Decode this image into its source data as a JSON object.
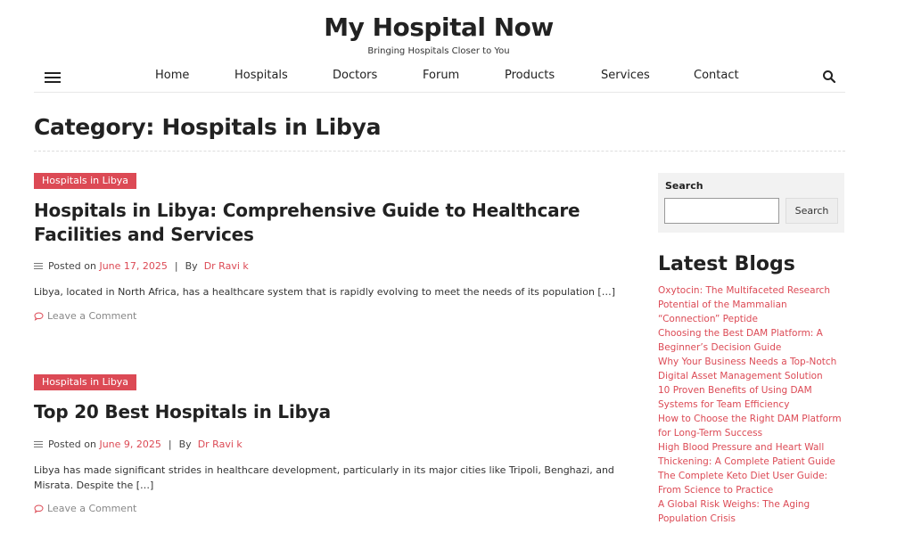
{
  "site": {
    "title": "My Hospital Now",
    "tagline": "Bringing Hospitals Closer to You"
  },
  "nav": {
    "menu_icon": "hamburger-icon",
    "items": [
      "Home",
      "Hospitals",
      "Doctors",
      "Forum",
      "Products",
      "Services",
      "Contact"
    ],
    "search_icon": "search-icon"
  },
  "page": {
    "title": "Category: Hospitals in Libya"
  },
  "posts": [
    {
      "category": "Hospitals in Libya",
      "title": "Hospitals in Libya: Comprehensive Guide to Healthcare Facilities and Services",
      "posted_on": "Posted on",
      "date": "June 17, 2025",
      "by": "By",
      "author": "Dr Ravi k",
      "excerpt": "Libya, located in North Africa, has a healthcare system that is rapidly evolving to meet the needs of its population […]",
      "comment": "Leave a Comment"
    },
    {
      "category": "Hospitals in Libya",
      "title": "Top 20 Best Hospitals in Libya",
      "posted_on": "Posted on",
      "date": "June 9, 2025",
      "by": "By",
      "author": "Dr Ravi k",
      "excerpt": "Libya has made significant strides in healthcare development, particularly in its major cities like Tripoli, Benghazi, and Misrata. Despite the […]",
      "comment": "Leave a Comment"
    }
  ],
  "sidebar": {
    "search": {
      "label": "Search",
      "input_value": "",
      "button": "Search"
    },
    "latest_title": "Latest Blogs",
    "latest_items": [
      "Oxytocin: The Multifaceted Research Potential of the Mammalian “Connection” Peptide",
      "Choosing the Best DAM Platform: A Beginner’s Decision Guide",
      "Why Your Business Needs a Top-Notch Digital Asset Management Solution",
      "10 Proven Benefits of Using DAM Systems for Team Efficiency",
      "How to Choose the Right DAM Platform for Long-Term Success",
      "High Blood Pressure and Heart Wall Thickening: A Complete Patient Guide",
      "The Complete Keto Diet User Guide: From Science to Practice",
      "A Global Risk Weighs: The Aging Population Crisis"
    ]
  },
  "colors": {
    "accent": "#dc4a55",
    "text": "#222222",
    "sidebar_bg": "#f2f2f2"
  }
}
